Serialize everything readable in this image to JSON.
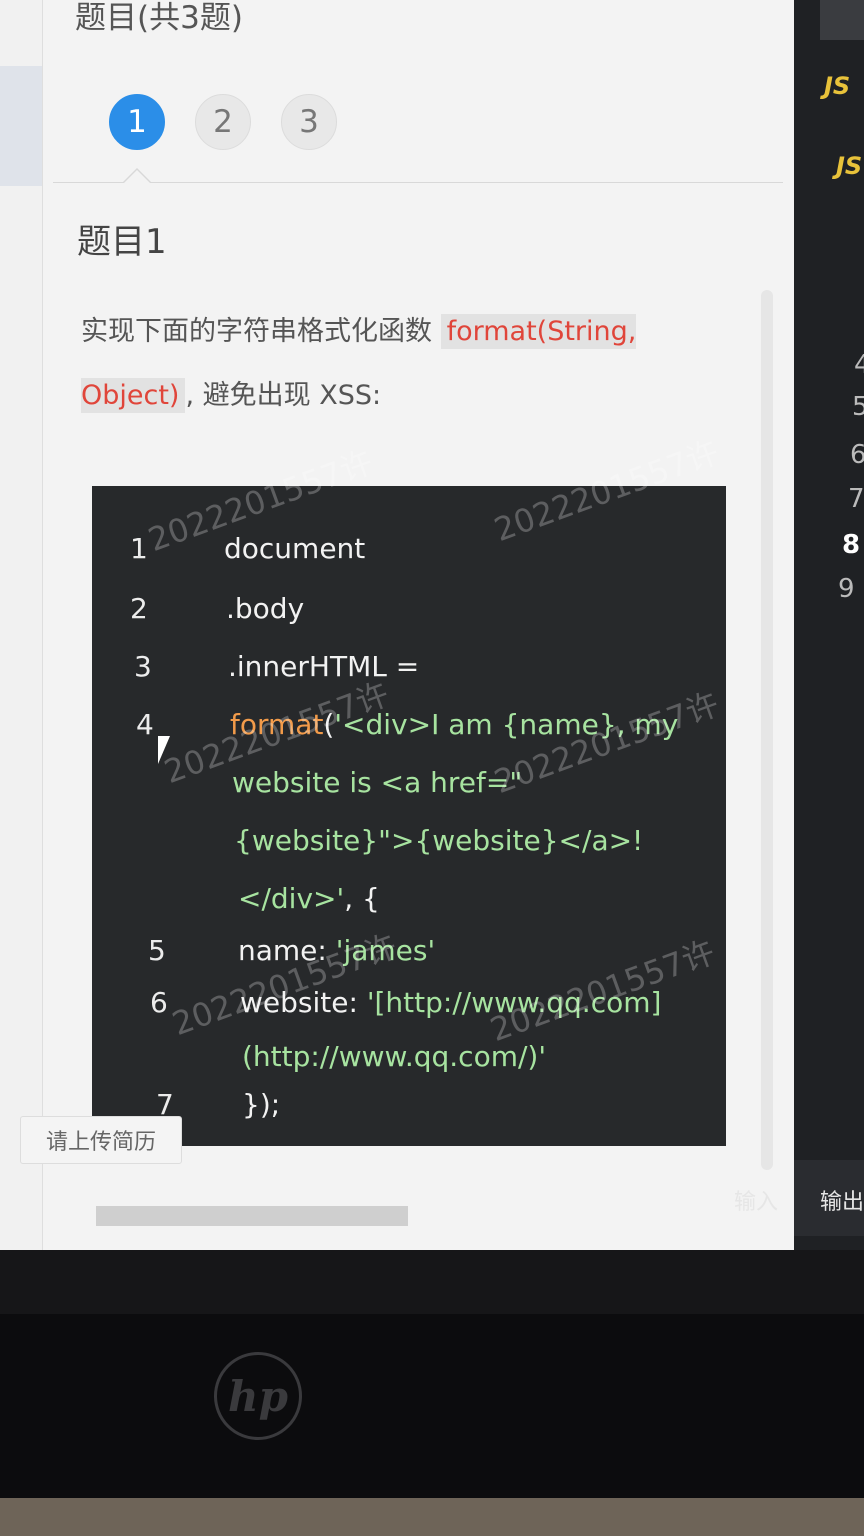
{
  "header": {
    "title": "题目(共3题)"
  },
  "tabs": [
    {
      "label": "1",
      "active": true
    },
    {
      "label": "2",
      "active": false
    },
    {
      "label": "3",
      "active": false
    }
  ],
  "question": {
    "title": "题目1",
    "desc_prefix": "实现下面的字符串格式化函数 ",
    "desc_code": "format(String, Object)",
    "desc_suffix": ", 避免出现 XSS:"
  },
  "code_lines": {
    "n1": "1",
    "n2": "2",
    "n3": "3",
    "n4": "4",
    "n5": "5",
    "n6": "6",
    "n7": "7",
    "l1": "document",
    "l2": ".body",
    "l3": ".innerHTML =",
    "l4_fn": "format",
    "l4_paren": "(",
    "l4_a": "'<div>I am {name}, my",
    "l4_b": "website is <a href=\"",
    "l4_c": "{website}\">{website}</a>!",
    "l4_d": "</div>'",
    "l4_e": ", {",
    "l5_key": "name: ",
    "l5_val": "'james'",
    "l6_key": "website: ",
    "l6_val_a": "'[http://www.qq.com]",
    "l6_val_b": "(http://www.qq.com/)'",
    "l7": "});"
  },
  "watermark": "2022201557许",
  "upload_tip": "请上传简历",
  "right_panel": {
    "file_labels": [
      "JS",
      "JS"
    ],
    "line_numbers": [
      "4",
      "5",
      "6",
      "7",
      "8",
      "9"
    ],
    "bottom_tabs": [
      "输入",
      "输出"
    ]
  },
  "bezel": {
    "logo": "hp"
  },
  "colors": {
    "accent": "#2b8ee8",
    "code_bg": "#27292b",
    "string": "#a7e3a0",
    "function": "#f29b4a",
    "inline_code": "#e0453a"
  }
}
